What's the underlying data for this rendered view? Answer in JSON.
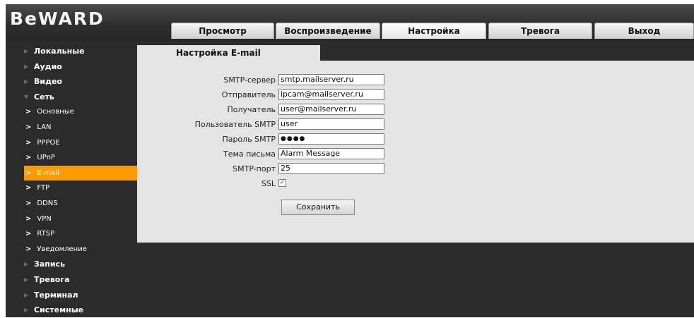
{
  "header": {
    "logo": "BeWARD",
    "tabs": [
      {
        "label": "Просмотр"
      },
      {
        "label": "Воспроизведение"
      },
      {
        "label": "Настройка"
      },
      {
        "label": "Тревога"
      },
      {
        "label": "Выход"
      }
    ],
    "active_tab": "Настройка"
  },
  "sidebar": {
    "items": [
      {
        "label": "Локальные",
        "level": "top"
      },
      {
        "label": "Аудио",
        "level": "top"
      },
      {
        "label": "Видео",
        "level": "top"
      },
      {
        "label": "Сеть",
        "level": "top",
        "expanded": true
      },
      {
        "label": "Основные",
        "level": "sub"
      },
      {
        "label": "LAN",
        "level": "sub"
      },
      {
        "label": "PPPOE",
        "level": "sub"
      },
      {
        "label": "UPnP",
        "level": "sub"
      },
      {
        "label": "E-mail",
        "level": "sub",
        "active": true
      },
      {
        "label": "FTP",
        "level": "sub"
      },
      {
        "label": "DDNS",
        "level": "sub"
      },
      {
        "label": "VPN",
        "level": "sub"
      },
      {
        "label": "RTSP",
        "level": "sub"
      },
      {
        "label": "Уведомление",
        "level": "sub"
      },
      {
        "label": "Запись",
        "level": "top"
      },
      {
        "label": "Тревога",
        "level": "top"
      },
      {
        "label": "Терминал",
        "level": "top"
      },
      {
        "label": "Системные",
        "level": "top"
      }
    ]
  },
  "form": {
    "title": "Настройка E-mail",
    "fields": [
      {
        "label": "SMTP-сервер",
        "value": "smtp.mailserver.ru"
      },
      {
        "label": "Отправитель",
        "value": "ipcam@mailserver.ru"
      },
      {
        "label": "Получатель",
        "value": "user@mailserver.ru"
      },
      {
        "label": "Пользователь SMTP",
        "value": "user"
      },
      {
        "label": "Пароль SMTP",
        "value": "●●●●"
      },
      {
        "label": "Тема письма",
        "value": "Alarm Message"
      },
      {
        "label": "SMTP-порт",
        "value": "25"
      }
    ],
    "ssl": {
      "label": "SSL",
      "checked": true,
      "mark": "✓"
    },
    "save_label": "Сохранить"
  },
  "colors": {
    "background": "#2b2b2b",
    "content_panel": "#e4e4e4",
    "active_item": "#ff9a00",
    "sidebar_text": "#ffffff"
  }
}
